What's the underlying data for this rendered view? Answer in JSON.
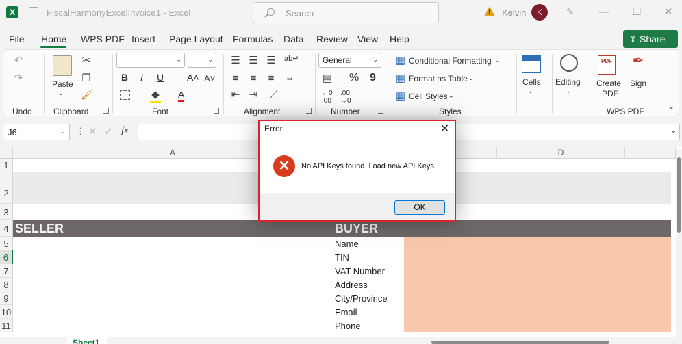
{
  "window": {
    "title": "FiscalHarmonyExcelInvoice1  -  Excel",
    "search_placeholder": "Search",
    "user_name": "Kelvin",
    "user_initial": "K",
    "app_letter": "X"
  },
  "menu": {
    "items": [
      "File",
      "Home",
      "WPS PDF",
      "Insert",
      "Page Layout",
      "Formulas",
      "Data",
      "Review",
      "View",
      "Help"
    ],
    "active": "Home",
    "share_label": "Share"
  },
  "ribbon": {
    "groups": {
      "undo": "Undo",
      "clipboard": "Clipboard",
      "font": "Font",
      "alignment": "Alignment",
      "number": "Number",
      "styles": "Styles",
      "wps_pdf": "WPS PDF"
    },
    "paste": "Paste",
    "number_format": "General",
    "conditional_formatting": "Conditional Formatting",
    "format_as_table": "Format as Table",
    "cell_styles": "Cell Styles",
    "cells": "Cells",
    "editing": "Editing",
    "create_pdf_line1": "Create",
    "create_pdf_line2": "PDF",
    "sign": "Sign",
    "font_bold": "B",
    "font_italic": "I",
    "font_underline": "U"
  },
  "formula_bar": {
    "name_box": "J6",
    "fx": "fx"
  },
  "sheet": {
    "columns": [
      "A",
      "D"
    ],
    "rows": [
      "1",
      "2",
      "3",
      "4",
      "5",
      "6",
      "7",
      "8",
      "9",
      "10",
      "11"
    ],
    "seller_label": "SELLER",
    "buyer_label": "BUYER",
    "buyer_fields": [
      "Name",
      "TIN",
      "VAT Number",
      "Address",
      "City/Province",
      "Email",
      "Phone"
    ],
    "sheet_tab": "Sheet1"
  },
  "dialog": {
    "title": "Error",
    "message": "No API Keys found. Load new API Keys",
    "ok_label": "OK",
    "close_glyph": "✕"
  },
  "colors": {
    "accent": "#107c41",
    "header_band": "#6e6767",
    "buyer_fill": "#f7c8ac",
    "dialog_border": "#d9232f"
  }
}
